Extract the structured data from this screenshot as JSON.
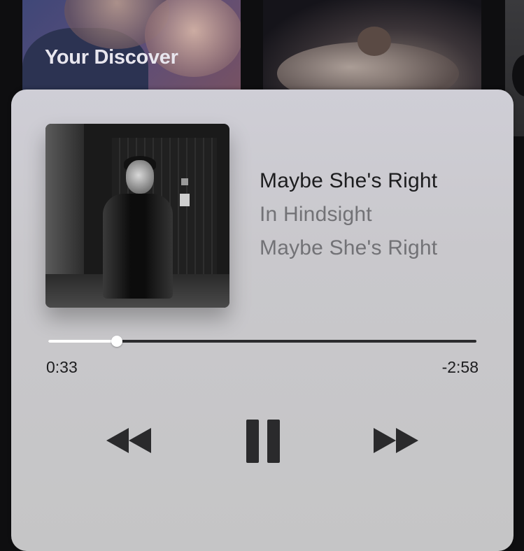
{
  "background": {
    "tiles": [
      {
        "label": "Your Discover"
      }
    ]
  },
  "now_playing": {
    "title": "Maybe She's Right",
    "album": "In Hindsight",
    "artist": "Maybe She's Right",
    "elapsed": "0:33",
    "remaining": "-2:58",
    "progress_fraction": 0.16
  },
  "controls": {
    "rewind_icon": "rewind-icon",
    "pause_icon": "pause-icon",
    "forward_icon": "fast-forward-icon"
  },
  "colors": {
    "card_background": "#c9c8cc",
    "title_text": "#1d1d1f",
    "secondary_text": "#727276",
    "scrubber_fill": "#ffffff",
    "scrubber_track": "#2b2b2d"
  }
}
